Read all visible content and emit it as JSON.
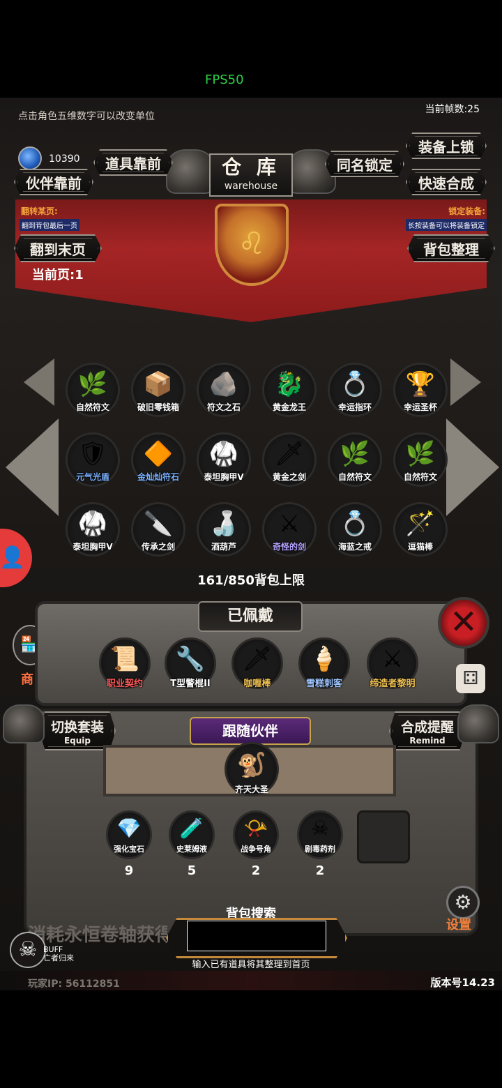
{
  "status_bar": {
    "fps": "FPS50"
  },
  "header": {
    "hint": "点击角色五维数字可以改变单位",
    "current_fps": "当前帧数:25",
    "gem_count": "10390",
    "title_cn": "仓 库",
    "title_en": "warehouse"
  },
  "buttons": {
    "items_front": "道具靠前",
    "partner_front": "伙伴靠前",
    "same_name_lock": "同名锁定",
    "equip_lock": "装备上锁",
    "quick_merge": "快速合成",
    "goto_last": "翻到末页",
    "bag_sort": "背包整理",
    "switch_set": "切换套装",
    "switch_set_en": "Equip",
    "merge_remind": "合成提醒",
    "merge_remind_en": "Remind"
  },
  "banner": {
    "left_label": "翻转某页:",
    "left_sub": "翻到背包最后一页",
    "right_label": "锁定装备:",
    "right_sub": "长按装备可以将装备锁定"
  },
  "page_info": "当前页:1",
  "inventory": [
    {
      "name": "自然符文",
      "icon": "🌿",
      "color": "white"
    },
    {
      "name": "破旧零钱箱",
      "icon": "📦",
      "color": "white"
    },
    {
      "name": "符文之石",
      "icon": "🪨",
      "color": "white"
    },
    {
      "name": "黄金龙王",
      "icon": "🐉",
      "color": "white"
    },
    {
      "name": "幸运指环",
      "icon": "💍",
      "color": "white"
    },
    {
      "name": "幸运圣杯",
      "icon": "🏆",
      "color": "white"
    },
    {
      "name": "元气光盾",
      "icon": "🛡",
      "color": "blue"
    },
    {
      "name": "金灿灿符石",
      "icon": "🔶",
      "color": "blue"
    },
    {
      "name": "泰坦胸甲V",
      "icon": "🥋",
      "color": "white"
    },
    {
      "name": "黄金之剑",
      "icon": "🗡",
      "color": "white"
    },
    {
      "name": "自然符文",
      "icon": "🌿",
      "color": "white"
    },
    {
      "name": "自然符文",
      "icon": "🌿",
      "color": "white"
    },
    {
      "name": "泰坦胸甲V",
      "icon": "🥋",
      "color": "white"
    },
    {
      "name": "传承之剑",
      "icon": "🔪",
      "color": "white"
    },
    {
      "name": "酒葫芦",
      "icon": "🍶",
      "color": "white"
    },
    {
      "name": "奇怪的剑",
      "icon": "⚔",
      "color": "purple"
    },
    {
      "name": "海蓝之戒",
      "icon": "💍",
      "color": "white"
    },
    {
      "name": "逗猫棒",
      "icon": "🪄",
      "color": "white"
    }
  ],
  "capacity": "161/850背包上限",
  "equipped": {
    "title": "已佩戴",
    "items": [
      {
        "name": "职业契约",
        "icon": "📜",
        "color": "#ff5a5a"
      },
      {
        "name": "T型警棍II",
        "icon": "🔧",
        "color": "#ffffff"
      },
      {
        "name": "咖喱棒",
        "icon": "🗡",
        "color": "#f3c455"
      },
      {
        "name": "雪糕刺客",
        "icon": "🍦",
        "color": "#9fc6ff"
      },
      {
        "name": "缔造者黎明",
        "icon": "⚔",
        "color": "#f3c455"
      }
    ]
  },
  "companion": {
    "title": "跟随伙伴",
    "name": "齐天大圣",
    "icon": "🐒"
  },
  "consumables": [
    {
      "name": "强化宝石",
      "icon": "💎",
      "count": "9"
    },
    {
      "name": "史莱姆液",
      "icon": "🧪",
      "count": "5"
    },
    {
      "name": "战争号角",
      "icon": "📯",
      "count": "2"
    },
    {
      "name": "剧毒药剂",
      "icon": "☠",
      "count": "2"
    }
  ],
  "search": {
    "label": "背包搜索",
    "placeholder": "",
    "hint": "输入已有道具将其整理到首页"
  },
  "footer": {
    "scroll_text": "消耗永恒卷轴获得",
    "buff": "BUFF",
    "buff_sub": "亡者归来",
    "player_ip": "玩家IP: 56112851",
    "version": "版本号14.23",
    "settings": "设置",
    "shop": "商"
  }
}
